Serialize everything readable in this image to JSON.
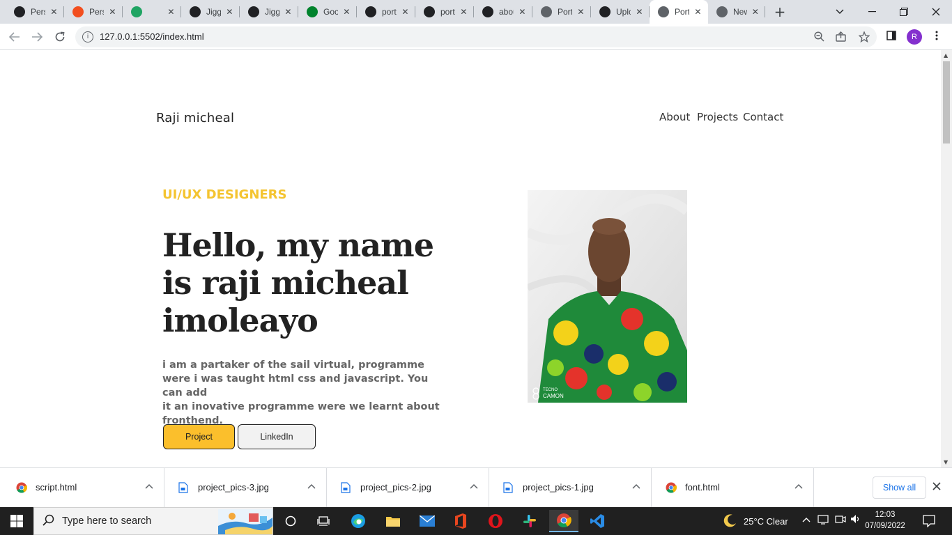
{
  "browser": {
    "tabs": [
      {
        "title": "Personal",
        "icon": "shield-icon",
        "icon_color": "#202124"
      },
      {
        "title": "Personal",
        "icon": "figma-icon",
        "icon_color": "#f24e1e"
      },
      {
        "title": "",
        "icon": "audio-icon",
        "icon_color": "#1fa463"
      },
      {
        "title": "Jiggy",
        "icon": "github-icon",
        "icon_color": "#202124"
      },
      {
        "title": "Jiggy",
        "icon": "github-icon",
        "icon_color": "#202124"
      },
      {
        "title": "Google",
        "icon": "meet-icon",
        "icon_color": "#00832d"
      },
      {
        "title": "portfolio",
        "icon": "github-icon",
        "icon_color": "#202124"
      },
      {
        "title": "portfolio",
        "icon": "github-icon",
        "icon_color": "#202124"
      },
      {
        "title": "about",
        "icon": "github-icon",
        "icon_color": "#202124"
      },
      {
        "title": "Portfolio",
        "icon": "globe-icon",
        "icon_color": "#5f6368"
      },
      {
        "title": "Upload",
        "icon": "github-icon",
        "icon_color": "#202124"
      },
      {
        "title": "Portfolio",
        "icon": "globe-icon",
        "icon_color": "#5f6368",
        "active": true
      },
      {
        "title": "New Tab",
        "icon": "chrome-icon",
        "icon_color": "#5f6368"
      }
    ],
    "url": "127.0.0.1:5502/index.html",
    "profile_initial": "R",
    "profile_color": "#8430ce"
  },
  "site": {
    "brand": "Raji micheal",
    "nav": [
      "About",
      "Projects",
      "Contact"
    ],
    "eyebrow": "UI/UX DESIGNERS",
    "headline_lines": [
      "Hello, my name",
      "is raji micheal",
      "imoleayo"
    ],
    "intro_lines": [
      "i am a partaker of the sail virtual, programme",
      "were i was taught html css and javascript. You can add",
      "it an inovative programme were we learnt about",
      "fronthend."
    ],
    "buttons": {
      "project": "Project",
      "linkedin": "LinkedIn"
    },
    "portrait_watermark": [
      "TECNO",
      "CAMON"
    ],
    "accent_color": "#f4c430",
    "button_color": "#fbbf2c"
  },
  "downloads": {
    "items": [
      {
        "name": "script.html",
        "icon": "chrome-icon"
      },
      {
        "name": "project_pics-3.jpg",
        "icon": "file-icon"
      },
      {
        "name": "project_pics-2.jpg",
        "icon": "file-icon"
      },
      {
        "name": "project_pics-1.jpg",
        "icon": "file-icon"
      },
      {
        "name": "font.html",
        "icon": "chrome-icon"
      }
    ],
    "show_all": "Show all"
  },
  "taskbar": {
    "search_placeholder": "Type here to search",
    "weather": "25°C  Clear",
    "time": "12:03",
    "date": "07/09/2022"
  }
}
